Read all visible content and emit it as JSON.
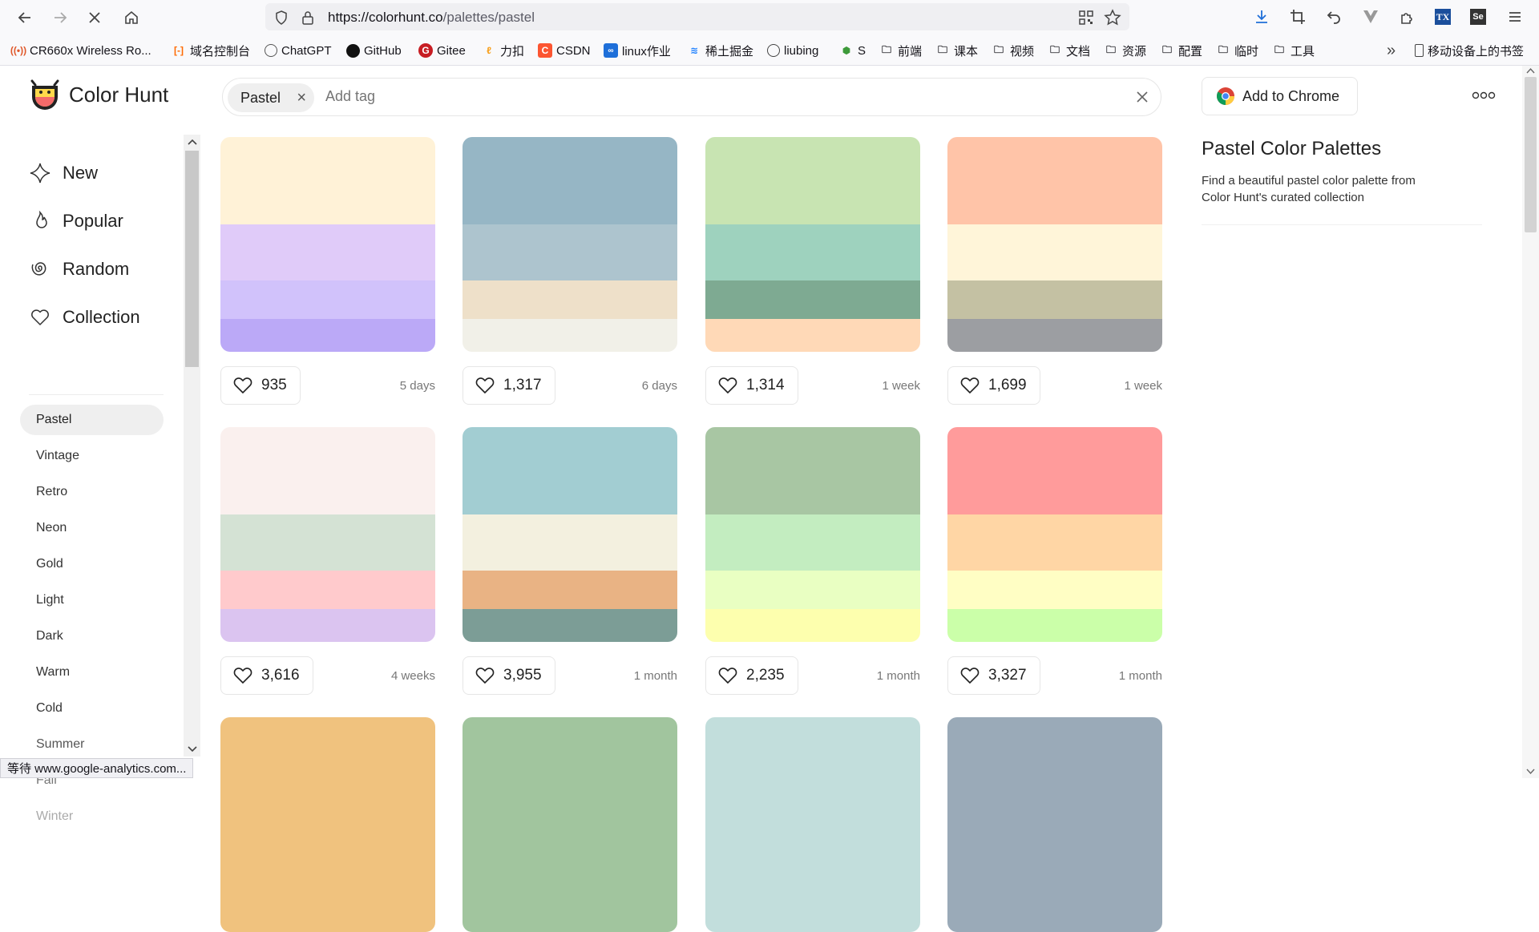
{
  "browser": {
    "url_host": "https://colorhunt.co",
    "url_path": "/palettes/pastel",
    "bookmarks": [
      {
        "label": "CR660x Wireless Ro...",
        "icon": "wifi-icon"
      },
      {
        "label": "域名控制台",
        "icon": "aliyun-icon"
      },
      {
        "label": "ChatGPT",
        "icon": "chatgpt-icon"
      },
      {
        "label": "GitHub",
        "icon": "github-icon"
      },
      {
        "label": "Gitee",
        "icon": "gitee-icon"
      },
      {
        "label": "力扣",
        "icon": "leetcode-icon"
      },
      {
        "label": "CSDN",
        "icon": "csdn-icon"
      },
      {
        "label": "linux作业",
        "icon": "link-icon"
      },
      {
        "label": "稀土掘金",
        "icon": "juejin-icon"
      },
      {
        "label": "liubing",
        "icon": "globe-icon"
      },
      {
        "label": "S",
        "icon": "node-icon"
      },
      {
        "label": "前端",
        "icon": "folder-icon"
      },
      {
        "label": "课本",
        "icon": "folder-icon"
      },
      {
        "label": "视频",
        "icon": "folder-icon"
      },
      {
        "label": "文档",
        "icon": "folder-icon"
      },
      {
        "label": "资源",
        "icon": "folder-icon"
      },
      {
        "label": "配置",
        "icon": "folder-icon"
      },
      {
        "label": "临时",
        "icon": "folder-icon"
      },
      {
        "label": "工具",
        "icon": "folder-icon"
      }
    ],
    "mobile_bookmarks": "移动设备上的书签",
    "status_text": "等待 www.google-analytics.com..."
  },
  "header": {
    "logo_text": "Color Hunt",
    "tag_chip": "Pastel",
    "tag_placeholder": "Add tag",
    "add_chrome_label": "Add to Chrome"
  },
  "sidebar": {
    "main_nav": [
      "New",
      "Popular",
      "Random",
      "Collection"
    ],
    "tags": [
      "Pastel",
      "Vintage",
      "Retro",
      "Neon",
      "Gold",
      "Light",
      "Dark",
      "Warm",
      "Cold",
      "Summer",
      "Fall",
      "Winter"
    ],
    "active_tag": "Pastel"
  },
  "info": {
    "title": "Pastel Color Palettes",
    "description": "Find a beautiful pastel color palette from Color Hunt's curated collection"
  },
  "palettes": [
    {
      "colors": [
        "#FFF2D7",
        "#E0CBF9",
        "#D1C2FB",
        "#BBA9F7"
      ],
      "likes": "935",
      "age": "5 days"
    },
    {
      "colors": [
        "#96B6C5",
        "#ADC4CE",
        "#EEE0C9",
        "#F1F0E8"
      ],
      "likes": "1,317",
      "age": "6 days"
    },
    {
      "colors": [
        "#C8E4B2",
        "#9ED2BE",
        "#7EAA92",
        "#FFD9B7"
      ],
      "likes": "1,314",
      "age": "1 week"
    },
    {
      "colors": [
        "#FFC4A8",
        "#FFF5D9",
        "#C4C1A3",
        "#9C9EA2"
      ],
      "likes": "1,699",
      "age": "1 week"
    },
    {
      "colors": [
        "#FAF0EE",
        "#D4E2D4",
        "#FFCACC",
        "#DBC4F0"
      ],
      "likes": "3,616",
      "age": "4 weeks"
    },
    {
      "colors": [
        "#A2CDD2",
        "#F3F0DF",
        "#E9B384",
        "#7C9D96"
      ],
      "likes": "3,955",
      "age": "1 month"
    },
    {
      "colors": [
        "#A8C6A3",
        "#C3EDC0",
        "#E9FFC2",
        "#FDFFAE"
      ],
      "likes": "2,235",
      "age": "1 month"
    },
    {
      "colors": [
        "#FF9B9B",
        "#FFD6A5",
        "#FFFEC4",
        "#CBFFA9"
      ],
      "likes": "3,327",
      "age": "1 month"
    },
    {
      "colors": [
        "#F0C27E",
        "#F0C27E",
        "#F0C27E",
        "#F0C27E"
      ],
      "likes": "",
      "age": ""
    },
    {
      "colors": [
        "#A1C59E",
        "#A1C59E",
        "#A1C59E",
        "#A1C59E"
      ],
      "likes": "",
      "age": ""
    },
    {
      "colors": [
        "#C2DEDC",
        "#C2DEDC",
        "#C2DEDC",
        "#C2DEDC"
      ],
      "likes": "",
      "age": ""
    },
    {
      "colors": [
        "#9AAAB8",
        "#9AAAB8",
        "#9AAAB8",
        "#9AAAB8"
      ],
      "likes": "",
      "age": ""
    }
  ]
}
